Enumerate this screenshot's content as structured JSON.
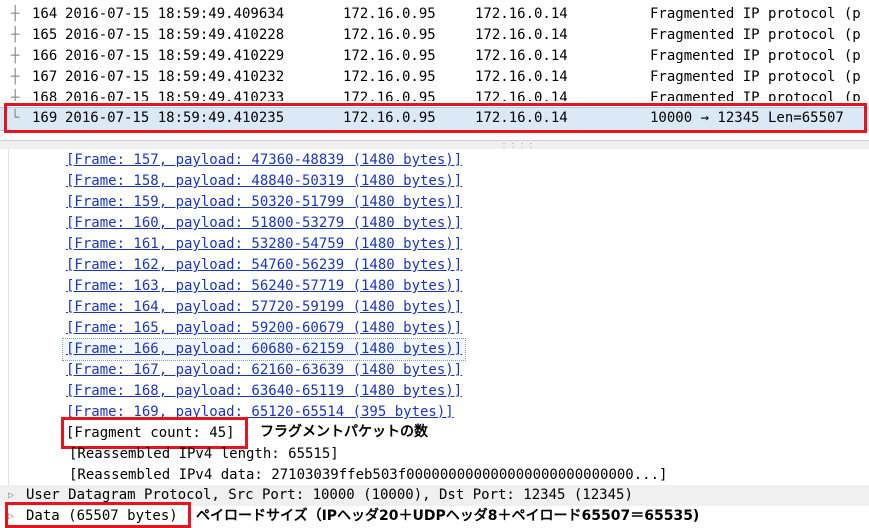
{
  "packet_list": {
    "rows": [
      {
        "no": "164",
        "time": "2016-07-15 18:59:49.409634",
        "src": "172.16.0.95",
        "dst": "172.16.0.14",
        "info": "Fragmented IP protocol (p"
      },
      {
        "no": "165",
        "time": "2016-07-15 18:59:49.410228",
        "src": "172.16.0.95",
        "dst": "172.16.0.14",
        "info": "Fragmented IP protocol (p"
      },
      {
        "no": "166",
        "time": "2016-07-15 18:59:49.410229",
        "src": "172.16.0.95",
        "dst": "172.16.0.14",
        "info": "Fragmented IP protocol (p"
      },
      {
        "no": "167",
        "time": "2016-07-15 18:59:49.410232",
        "src": "172.16.0.95",
        "dst": "172.16.0.14",
        "info": "Fragmented IP protocol (p"
      },
      {
        "no": "168",
        "time": "2016-07-15 18:59:49.410233",
        "src": "172.16.0.95",
        "dst": "172.16.0.14",
        "info": "Fragmented IP protocol (p"
      }
    ],
    "selected": {
      "no": "169",
      "time": "2016-07-15 18:59:49.410235",
      "src": "172.16.0.95",
      "dst": "172.16.0.14",
      "info": "10000 → 12345  Len=65507"
    }
  },
  "details": {
    "frames": [
      "[Frame: 157, payload: 47360-48839 (1480 bytes)]",
      "[Frame: 158, payload: 48840-50319 (1480 bytes)]",
      "[Frame: 159, payload: 50320-51799 (1480 bytes)]",
      "[Frame: 160, payload: 51800-53279 (1480 bytes)]",
      "[Frame: 161, payload: 53280-54759 (1480 bytes)]",
      "[Frame: 162, payload: 54760-56239 (1480 bytes)]",
      "[Frame: 163, payload: 56240-57719 (1480 bytes)]",
      "[Frame: 164, payload: 57720-59199 (1480 bytes)]",
      "[Frame: 165, payload: 59200-60679 (1480 bytes)]",
      "[Frame: 166, payload: 60680-62159 (1480 bytes)]",
      "[Frame: 167, payload: 62160-63639 (1480 bytes)]",
      "[Frame: 168, payload: 63640-65119 (1480 bytes)]",
      "[Frame: 169, payload: 65120-65514 (395 bytes)]"
    ],
    "fragment_count": "[Fragment count: 45]",
    "fragment_annotation": "フラグメントパケットの数",
    "reassembled_length": "[Reassembled IPv4 length: 65515]",
    "reassembled_data": "[Reassembled IPv4 data: 27103039ffeb503f000000000000000000000000000...]",
    "udp_line": "User Datagram Protocol, Src Port: 10000 (10000), Dst Port: 12345 (12345)",
    "data_line": "Data (65507 bytes)",
    "data_annotation": "ペイロードサイズ（IPヘッダ20＋UDPヘッダ8＋ペイロード65507＝65535)"
  },
  "colors": {
    "highlight": "#e8131d",
    "link": "#1a35c0",
    "selected_row": "#dbe9f7"
  }
}
